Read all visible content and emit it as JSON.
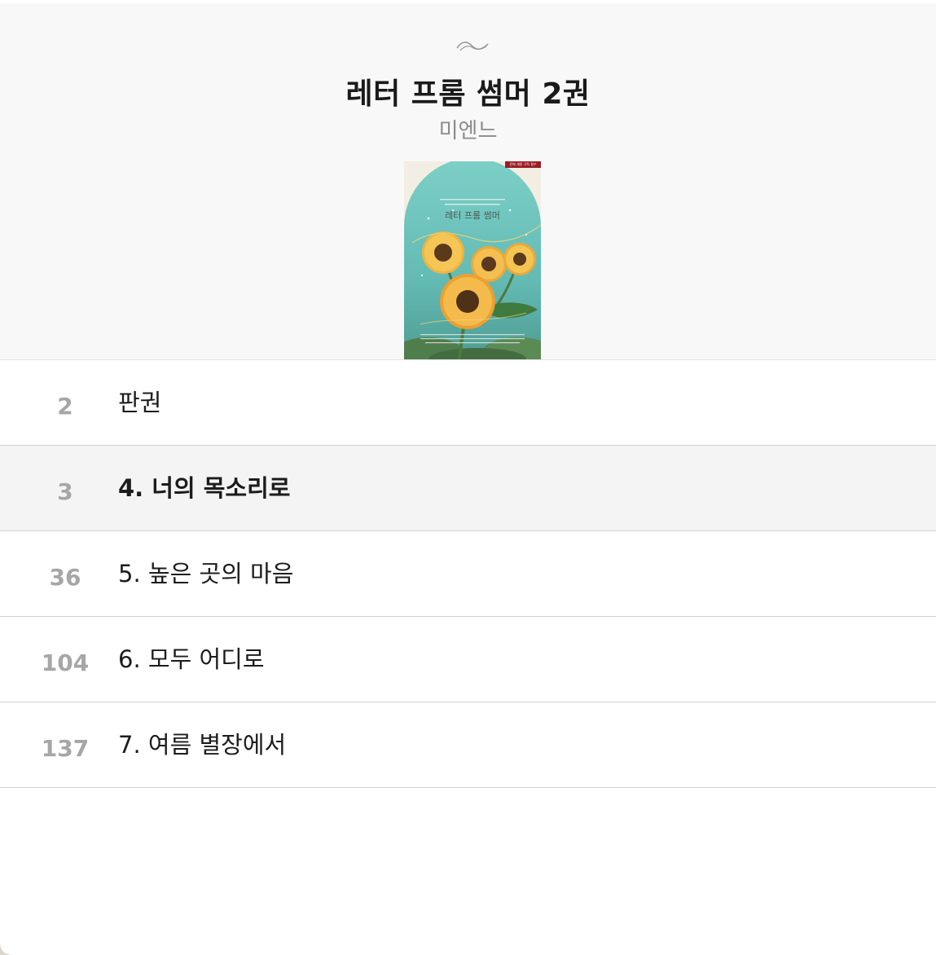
{
  "book": {
    "title": "레터 프롬 썸머 2권",
    "author": "미엔느"
  },
  "cover": {
    "title": "레터 프롬 썸머",
    "badge": "전체 개정 구독 필수",
    "colors": {
      "sky": "#6fc6bf",
      "frame": "#f3eee3",
      "badge": "#9b1c24",
      "petal": "#f0b440",
      "leaf": "#4f7d4c"
    }
  },
  "toc": {
    "items": [
      {
        "page": "2",
        "label": "판권",
        "current": false
      },
      {
        "page": "3",
        "label": "4. 너의 목소리로",
        "current": true
      },
      {
        "page": "36",
        "label": "5. 높은 곳의 마음",
        "current": false
      },
      {
        "page": "104",
        "label": "6. 모두 어디로",
        "current": false
      },
      {
        "page": "137",
        "label": "7. 여름 별장에서",
        "current": false
      }
    ]
  }
}
